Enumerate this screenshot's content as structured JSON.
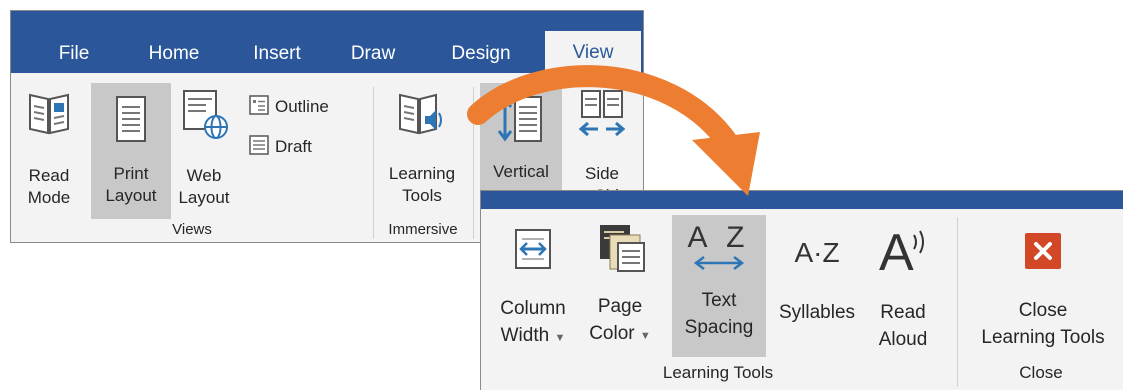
{
  "tabs": [
    {
      "label": "File",
      "active": false
    },
    {
      "label": "Home",
      "active": false
    },
    {
      "label": "Insert",
      "active": false
    },
    {
      "label": "Draw",
      "active": false
    },
    {
      "label": "Design",
      "active": false
    },
    {
      "label": "View",
      "active": true
    }
  ],
  "views_group": {
    "label": "Views",
    "read_mode": {
      "line1": "Read",
      "line2": "Mode",
      "icon": "read-mode-icon"
    },
    "print_layout": {
      "line1": "Print",
      "line2": "Layout",
      "icon": "print-layout-icon",
      "selected": true
    },
    "web_layout": {
      "line1": "Web",
      "line2": "Layout",
      "icon": "web-layout-icon"
    },
    "outline": {
      "label": "Outline",
      "icon": "outline-icon"
    },
    "draft": {
      "label": "Draft",
      "icon": "draft-icon"
    }
  },
  "immersive_group": {
    "label": "Immersive",
    "learning_tools": {
      "line1": "Learning",
      "line2": "Tools",
      "icon": "learning-tools-icon"
    }
  },
  "page_movement": {
    "vertical": {
      "line1": "Vertical",
      "icon": "vertical-icon",
      "selected": true
    },
    "side_to_side": {
      "line1": "Side",
      "line2": "to Side",
      "icon": "side-to-side-icon"
    }
  },
  "learning_tools_group": {
    "label": "Learning Tools",
    "column_width": {
      "line1": "Column",
      "line2": "Width",
      "icon": "column-width-icon",
      "dropdown": true
    },
    "page_color": {
      "line1": "Page",
      "line2": "Color",
      "icon": "page-color-icon",
      "dropdown": true
    },
    "text_spacing": {
      "line1": "Text",
      "line2": "Spacing",
      "icon": "text-spacing-icon",
      "selected": true,
      "glyph": "A Z"
    },
    "syllables": {
      "line1": "Syllables",
      "icon": "syllables-icon",
      "glyph": "A·Z"
    },
    "read_aloud": {
      "line1": "Read",
      "line2": "Aloud",
      "icon": "read-aloud-icon",
      "glyph": "A"
    }
  },
  "close_group": {
    "label": "Close",
    "close_learning_tools": {
      "line1": "Close",
      "line2": "Learning Tools",
      "icon": "close-x-icon"
    }
  },
  "colors": {
    "tab_bar": "#2b579a",
    "ribbon_bg": "#f3f3f3",
    "selected_bg": "#c8c8c8",
    "arrow": "#ed7d31",
    "close_red": "#d24726",
    "icon_blue": "#2e75b6"
  }
}
